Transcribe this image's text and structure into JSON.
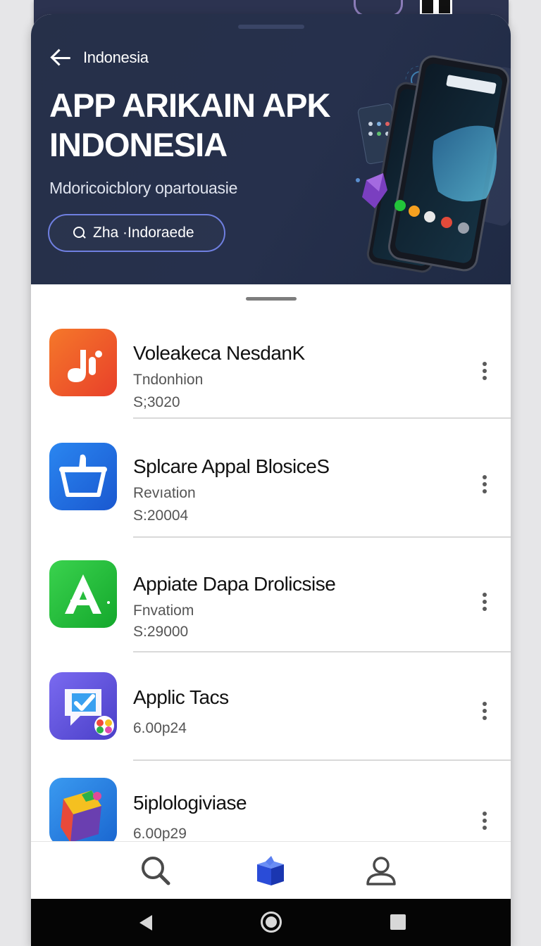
{
  "header": {
    "back_label": "Indonesia",
    "title_line1": "APP ARIKAIN APK",
    "title_line2": "INDONESIA",
    "subtitle": "Mdoricoicblory opartouasie",
    "search_text": "Zha ·Indoraede"
  },
  "apps": [
    {
      "name": "Voleakeca NesdanK",
      "line2": "Tndonhion",
      "line3": "S;3020",
      "icon": "music-note-icon",
      "color": "#f0542a"
    },
    {
      "name": "Splcare Appal BlosiceS",
      "line2": "Revıation",
      "line3": "S:20004",
      "icon": "shopping-basket-icon",
      "color": "#1e6ee0"
    },
    {
      "name": "Appiate Dapa Drolicsise",
      "line2": "Fnvatiom",
      "line3": "S:29000",
      "icon": "letter-a-icon",
      "color": "#22c43a"
    },
    {
      "name": "Applic Tacs",
      "line2": "",
      "line3": "6.00p24",
      "icon": "checkmark-badge-icon",
      "color": "#5a4fd6"
    },
    {
      "name": "5iplologiviase",
      "line2": "",
      "line3": "6.00p29",
      "icon": "colorful-cube-icon",
      "color": "#2a7ee0"
    }
  ],
  "bottom_nav": [
    "search-icon",
    "store-box-icon",
    "profile-icon"
  ],
  "system_nav": [
    "back-icon",
    "home-icon",
    "recents-icon"
  ]
}
